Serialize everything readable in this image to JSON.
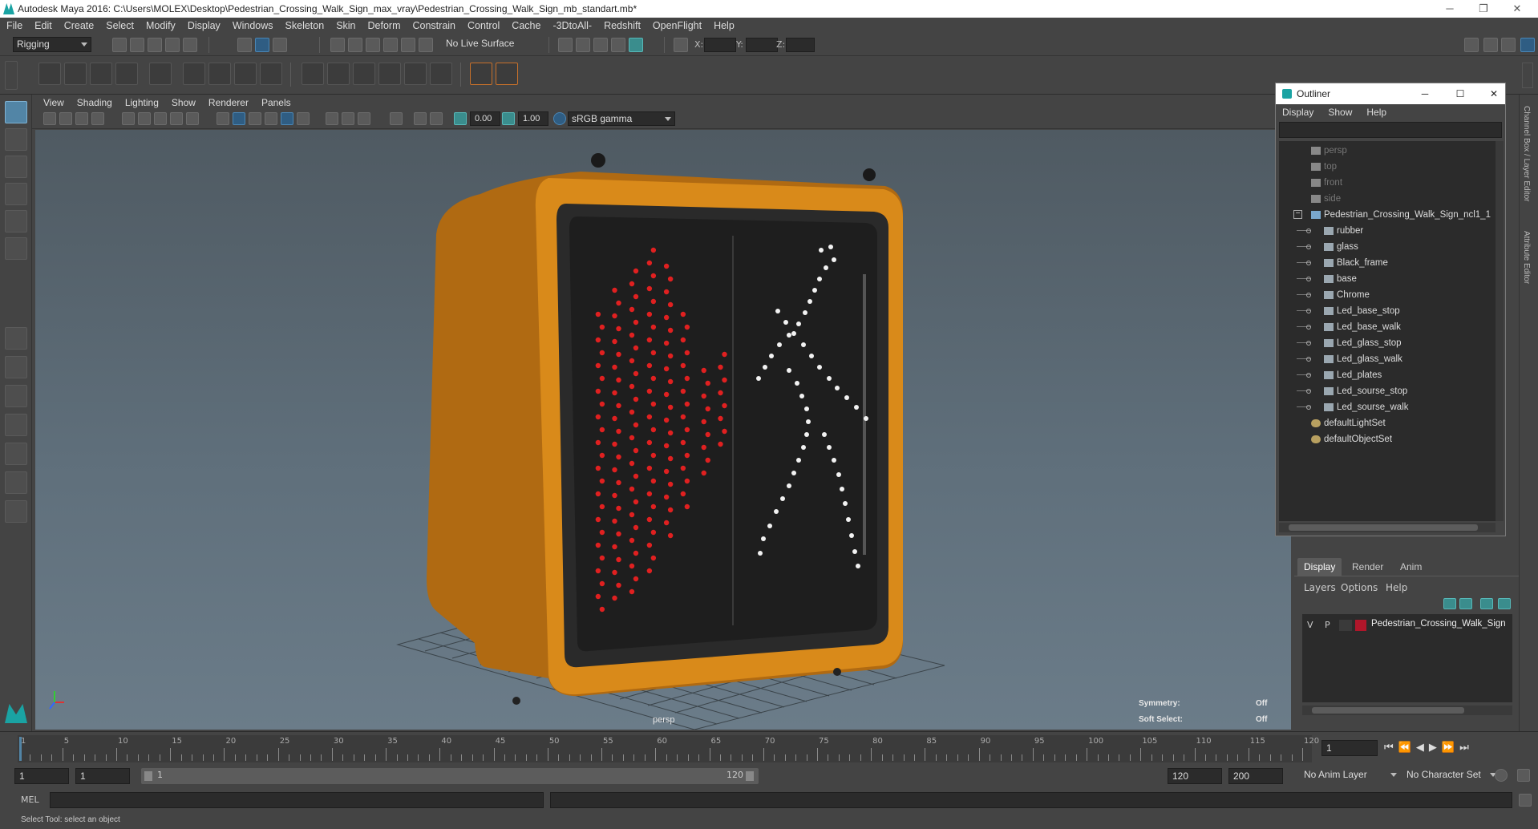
{
  "window": {
    "title": "Autodesk Maya 2016: C:\\Users\\MOLEX\\Desktop\\Pedestrian_Crossing_Walk_Sign_max_vray\\Pedestrian_Crossing_Walk_Sign_mb_standart.mb*"
  },
  "menubar": [
    "File",
    "Edit",
    "Create",
    "Select",
    "Modify",
    "Display",
    "Windows",
    "Skeleton",
    "Skin",
    "Deform",
    "Constrain",
    "Control",
    "Cache",
    "-3DtoAll-",
    "Redshift",
    "OpenFlight",
    "Help"
  ],
  "statusline": {
    "mode": "Rigging",
    "live_surface": "No Live Surface",
    "x_label": "X:",
    "y_label": "Y:",
    "z_label": "Z:"
  },
  "viewport": {
    "menu": [
      "View",
      "Shading",
      "Lighting",
      "Show",
      "Renderer",
      "Panels"
    ],
    "exposure": "0.00",
    "gamma": "1.00",
    "color_space": "sRGB gamma",
    "camera_label": "persp",
    "symmetry_label": "Symmetry:",
    "symmetry_value": "Off",
    "soft_select_label": "Soft Select:",
    "soft_select_value": "Off"
  },
  "outliner": {
    "title": "Outliner",
    "menu": [
      "Display",
      "Show",
      "Help"
    ],
    "items": [
      {
        "label": "persp",
        "type": "camera",
        "indent": 0
      },
      {
        "label": "top",
        "type": "camera",
        "indent": 0
      },
      {
        "label": "front",
        "type": "camera",
        "indent": 0
      },
      {
        "label": "side",
        "type": "camera",
        "indent": 0
      },
      {
        "label": "Pedestrian_Crossing_Walk_Sign_ncl1_1",
        "type": "group",
        "indent": 0
      },
      {
        "label": "rubber",
        "type": "mesh",
        "indent": 1
      },
      {
        "label": "glass",
        "type": "mesh",
        "indent": 1
      },
      {
        "label": "Black_frame",
        "type": "mesh",
        "indent": 1
      },
      {
        "label": "base",
        "type": "mesh",
        "indent": 1
      },
      {
        "label": "Chrome",
        "type": "mesh",
        "indent": 1
      },
      {
        "label": "Led_base_stop",
        "type": "mesh",
        "indent": 1
      },
      {
        "label": "Led_base_walk",
        "type": "mesh",
        "indent": 1
      },
      {
        "label": "Led_glass_stop",
        "type": "mesh",
        "indent": 1
      },
      {
        "label": "Led_glass_walk",
        "type": "mesh",
        "indent": 1
      },
      {
        "label": "Led_plates",
        "type": "mesh",
        "indent": 1
      },
      {
        "label": "Led_sourse_stop",
        "type": "mesh",
        "indent": 1
      },
      {
        "label": "Led_sourse_walk",
        "type": "mesh",
        "indent": 1
      },
      {
        "label": "defaultLightSet",
        "type": "set",
        "indent": 0
      },
      {
        "label": "defaultObjectSet",
        "type": "set",
        "indent": 0
      }
    ]
  },
  "layers": {
    "tabs": [
      "Display",
      "Render",
      "Anim"
    ],
    "menu": [
      "Layers",
      "Options",
      "Help"
    ],
    "layer": {
      "v": "V",
      "p": "P",
      "name": "Pedestrian_Crossing_Walk_Sign",
      "color": "#b0162a"
    }
  },
  "side_tabs": [
    "Channel Box / Layer Editor",
    "Attribute Editor"
  ],
  "timeline": {
    "ticks": [
      "1",
      "5",
      "10",
      "15",
      "20",
      "25",
      "30",
      "35",
      "40",
      "45",
      "50",
      "55",
      "60",
      "65",
      "70",
      "75",
      "80",
      "85",
      "90",
      "95",
      "100",
      "105",
      "110",
      "115",
      "120"
    ],
    "current_frame": "1"
  },
  "range": {
    "start": "1",
    "playback_start": "1",
    "slider_start": "1",
    "slider_end": "120",
    "playback_end": "120",
    "end": "200",
    "anim_layer": "No Anim Layer",
    "char_set": "No Character Set"
  },
  "cmdline": {
    "label": "MEL"
  },
  "help": {
    "text": "Select Tool: select an object"
  },
  "colors": {
    "sign_body": "#d98a1a",
    "stop_led": "#e02020",
    "walk_led": "#f2f2f2",
    "accent": "#5285a6"
  }
}
